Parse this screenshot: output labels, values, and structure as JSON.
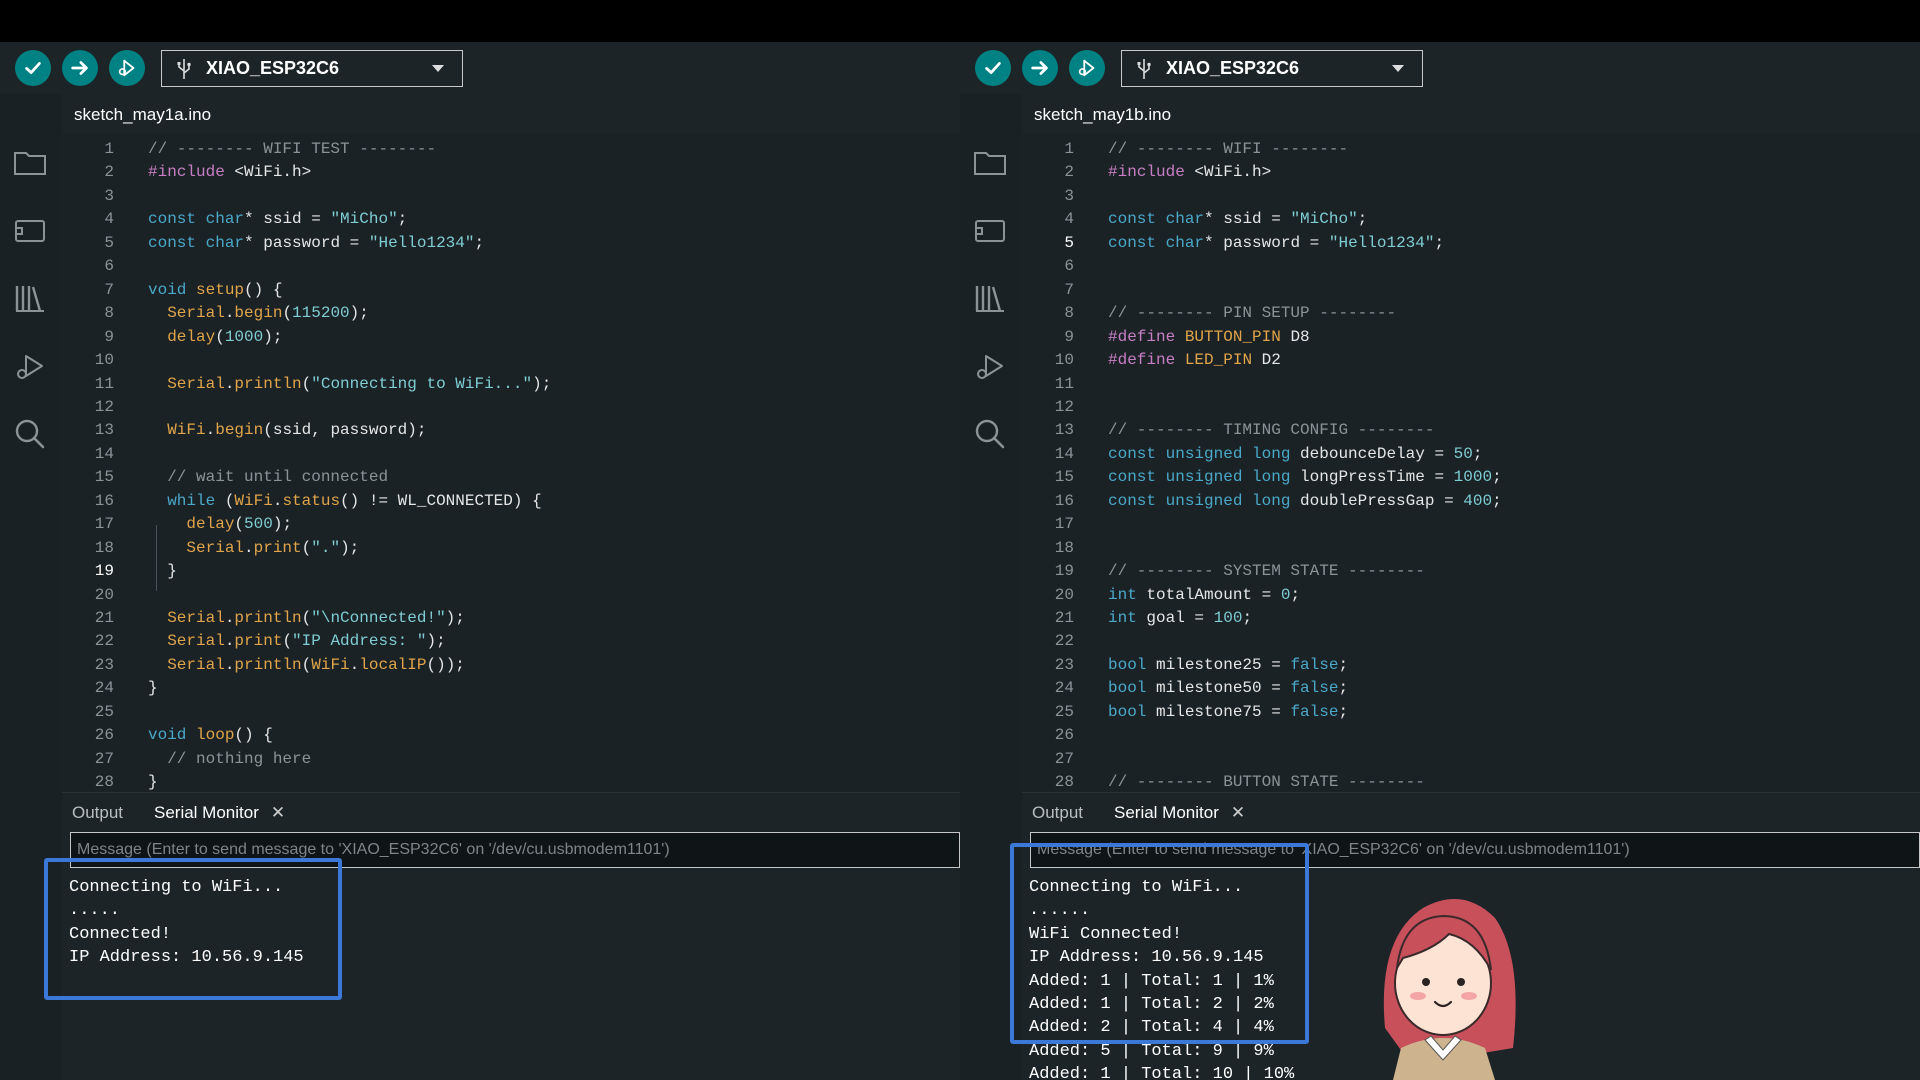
{
  "left": {
    "board": "XIAO_ESP32C6",
    "file_tab": "sketch_may1a.ino",
    "current_line": 19,
    "code": [
      [
        {
          "t": "// -------- WIFI TEST --------",
          "c": "comment"
        }
      ],
      [
        {
          "t": "#include",
          "c": "pre"
        },
        {
          "t": " <WiFi.h>",
          "c": "plain"
        }
      ],
      [],
      [
        {
          "t": "const",
          "c": "kw"
        },
        {
          "t": " ",
          "c": "plain"
        },
        {
          "t": "char",
          "c": "kw"
        },
        {
          "t": "* ssid = ",
          "c": "plain"
        },
        {
          "t": "\"MiCho\"",
          "c": "str"
        },
        {
          "t": ";",
          "c": "plain"
        }
      ],
      [
        {
          "t": "const",
          "c": "kw"
        },
        {
          "t": " ",
          "c": "plain"
        },
        {
          "t": "char",
          "c": "kw"
        },
        {
          "t": "* password = ",
          "c": "plain"
        },
        {
          "t": "\"Hello1234\"",
          "c": "str"
        },
        {
          "t": ";",
          "c": "plain"
        }
      ],
      [],
      [
        {
          "t": "void",
          "c": "kw"
        },
        {
          "t": " ",
          "c": "plain"
        },
        {
          "t": "setup",
          "c": "fn"
        },
        {
          "t": "() {",
          "c": "plain"
        }
      ],
      [
        {
          "t": "  ",
          "c": "plain"
        },
        {
          "t": "Serial",
          "c": "fn"
        },
        {
          "t": ".",
          "c": "plain"
        },
        {
          "t": "begin",
          "c": "fn"
        },
        {
          "t": "(",
          "c": "plain"
        },
        {
          "t": "115200",
          "c": "num"
        },
        {
          "t": ");",
          "c": "plain"
        }
      ],
      [
        {
          "t": "  ",
          "c": "plain"
        },
        {
          "t": "delay",
          "c": "fn"
        },
        {
          "t": "(",
          "c": "plain"
        },
        {
          "t": "1000",
          "c": "num"
        },
        {
          "t": ");",
          "c": "plain"
        }
      ],
      [],
      [
        {
          "t": "  ",
          "c": "plain"
        },
        {
          "t": "Serial",
          "c": "fn"
        },
        {
          "t": ".",
          "c": "plain"
        },
        {
          "t": "println",
          "c": "fn"
        },
        {
          "t": "(",
          "c": "plain"
        },
        {
          "t": "\"Connecting to WiFi...\"",
          "c": "str"
        },
        {
          "t": ");",
          "c": "plain"
        }
      ],
      [],
      [
        {
          "t": "  ",
          "c": "plain"
        },
        {
          "t": "WiFi",
          "c": "fn"
        },
        {
          "t": ".",
          "c": "plain"
        },
        {
          "t": "begin",
          "c": "fn"
        },
        {
          "t": "(ssid, password);",
          "c": "plain"
        }
      ],
      [],
      [
        {
          "t": "  // wait until connected",
          "c": "comment"
        }
      ],
      [
        {
          "t": "  ",
          "c": "plain"
        },
        {
          "t": "while",
          "c": "kw"
        },
        {
          "t": " (",
          "c": "plain"
        },
        {
          "t": "WiFi",
          "c": "fn"
        },
        {
          "t": ".",
          "c": "plain"
        },
        {
          "t": "status",
          "c": "fn"
        },
        {
          "t": "() != WL_CONNECTED) {",
          "c": "plain"
        }
      ],
      [
        {
          "t": "    ",
          "c": "plain"
        },
        {
          "t": "delay",
          "c": "fn"
        },
        {
          "t": "(",
          "c": "plain"
        },
        {
          "t": "500",
          "c": "num"
        },
        {
          "t": ");",
          "c": "plain"
        }
      ],
      [
        {
          "t": "    ",
          "c": "plain"
        },
        {
          "t": "Serial",
          "c": "fn"
        },
        {
          "t": ".",
          "c": "plain"
        },
        {
          "t": "print",
          "c": "fn"
        },
        {
          "t": "(",
          "c": "plain"
        },
        {
          "t": "\".\"",
          "c": "str"
        },
        {
          "t": ");",
          "c": "plain"
        }
      ],
      [
        {
          "t": "  }",
          "c": "plain"
        }
      ],
      [],
      [
        {
          "t": "  ",
          "c": "plain"
        },
        {
          "t": "Serial",
          "c": "fn"
        },
        {
          "t": ".",
          "c": "plain"
        },
        {
          "t": "println",
          "c": "fn"
        },
        {
          "t": "(",
          "c": "plain"
        },
        {
          "t": "\"\\nConnected!\"",
          "c": "str"
        },
        {
          "t": ");",
          "c": "plain"
        }
      ],
      [
        {
          "t": "  ",
          "c": "plain"
        },
        {
          "t": "Serial",
          "c": "fn"
        },
        {
          "t": ".",
          "c": "plain"
        },
        {
          "t": "print",
          "c": "fn"
        },
        {
          "t": "(",
          "c": "plain"
        },
        {
          "t": "\"IP Address: \"",
          "c": "str"
        },
        {
          "t": ");",
          "c": "plain"
        }
      ],
      [
        {
          "t": "  ",
          "c": "plain"
        },
        {
          "t": "Serial",
          "c": "fn"
        },
        {
          "t": ".",
          "c": "plain"
        },
        {
          "t": "println",
          "c": "fn"
        },
        {
          "t": "(",
          "c": "plain"
        },
        {
          "t": "WiFi",
          "c": "fn"
        },
        {
          "t": ".",
          "c": "plain"
        },
        {
          "t": "localIP",
          "c": "fn"
        },
        {
          "t": "());",
          "c": "plain"
        }
      ],
      [
        {
          "t": "}",
          "c": "plain"
        }
      ],
      [],
      [
        {
          "t": "void",
          "c": "kw"
        },
        {
          "t": " ",
          "c": "plain"
        },
        {
          "t": "loop",
          "c": "fn"
        },
        {
          "t": "() {",
          "c": "plain"
        }
      ],
      [
        {
          "t": "  // nothing here",
          "c": "comment"
        }
      ],
      [
        {
          "t": "}",
          "c": "plain"
        }
      ]
    ],
    "output_tab": "Output",
    "serial_tab": "Serial Monitor",
    "close_glyph": "✕",
    "message_placeholder": "Message (Enter to send message to 'XIAO_ESP32C6' on '/dev/cu.usbmodem1101')",
    "serial_output": [
      "Connecting to WiFi...",
      ".....",
      "Connected!",
      "IP Address: 10.56.9.145"
    ]
  },
  "right": {
    "board": "XIAO_ESP32C6",
    "file_tab": "sketch_may1b.ino",
    "current_line": 5,
    "code": [
      [
        {
          "t": "// -------- WIFI --------",
          "c": "comment"
        }
      ],
      [
        {
          "t": "#include",
          "c": "pre"
        },
        {
          "t": " <WiFi.h>",
          "c": "plain"
        }
      ],
      [],
      [
        {
          "t": "const",
          "c": "kw"
        },
        {
          "t": " ",
          "c": "plain"
        },
        {
          "t": "char",
          "c": "kw"
        },
        {
          "t": "* ssid = ",
          "c": "plain"
        },
        {
          "t": "\"MiCho\"",
          "c": "str"
        },
        {
          "t": ";",
          "c": "plain"
        }
      ],
      [
        {
          "t": "const",
          "c": "kw"
        },
        {
          "t": " ",
          "c": "plain"
        },
        {
          "t": "char",
          "c": "kw"
        },
        {
          "t": "* password = ",
          "c": "plain"
        },
        {
          "t": "\"Hello1234\"",
          "c": "str"
        },
        {
          "t": ";",
          "c": "plain"
        }
      ],
      [],
      [],
      [
        {
          "t": "// -------- PIN SETUP --------",
          "c": "comment"
        }
      ],
      [
        {
          "t": "#define",
          "c": "pre"
        },
        {
          "t": " ",
          "c": "plain"
        },
        {
          "t": "BUTTON_PIN",
          "c": "fn"
        },
        {
          "t": " D8",
          "c": "plain"
        }
      ],
      [
        {
          "t": "#define",
          "c": "pre"
        },
        {
          "t": " ",
          "c": "plain"
        },
        {
          "t": "LED_PIN",
          "c": "fn"
        },
        {
          "t": " D2",
          "c": "plain"
        }
      ],
      [],
      [],
      [
        {
          "t": "// -------- TIMING CONFIG --------",
          "c": "comment"
        }
      ],
      [
        {
          "t": "const unsigned long",
          "c": "kw"
        },
        {
          "t": " debounceDelay = ",
          "c": "plain"
        },
        {
          "t": "50",
          "c": "num"
        },
        {
          "t": ";",
          "c": "plain"
        }
      ],
      [
        {
          "t": "const unsigned long",
          "c": "kw"
        },
        {
          "t": " longPressTime = ",
          "c": "plain"
        },
        {
          "t": "1000",
          "c": "num"
        },
        {
          "t": ";",
          "c": "plain"
        }
      ],
      [
        {
          "t": "const unsigned long",
          "c": "kw"
        },
        {
          "t": " doublePressGap = ",
          "c": "plain"
        },
        {
          "t": "400",
          "c": "num"
        },
        {
          "t": ";",
          "c": "plain"
        }
      ],
      [],
      [],
      [
        {
          "t": "// -------- SYSTEM STATE --------",
          "c": "comment"
        }
      ],
      [
        {
          "t": "int",
          "c": "kw"
        },
        {
          "t": " totalAmount = ",
          "c": "plain"
        },
        {
          "t": "0",
          "c": "num"
        },
        {
          "t": ";",
          "c": "plain"
        }
      ],
      [
        {
          "t": "int",
          "c": "kw"
        },
        {
          "t": " goal = ",
          "c": "plain"
        },
        {
          "t": "100",
          "c": "num"
        },
        {
          "t": ";",
          "c": "plain"
        }
      ],
      [],
      [
        {
          "t": "bool",
          "c": "kw"
        },
        {
          "t": " milestone25 = ",
          "c": "plain"
        },
        {
          "t": "false",
          "c": "kw"
        },
        {
          "t": ";",
          "c": "plain"
        }
      ],
      [
        {
          "t": "bool",
          "c": "kw"
        },
        {
          "t": " milestone50 = ",
          "c": "plain"
        },
        {
          "t": "false",
          "c": "kw"
        },
        {
          "t": ";",
          "c": "plain"
        }
      ],
      [
        {
          "t": "bool",
          "c": "kw"
        },
        {
          "t": " milestone75 = ",
          "c": "plain"
        },
        {
          "t": "false",
          "c": "kw"
        },
        {
          "t": ";",
          "c": "plain"
        }
      ],
      [],
      [],
      [
        {
          "t": "// -------- BUTTON STATE --------",
          "c": "comment"
        }
      ]
    ],
    "output_tab": "Output",
    "serial_tab": "Serial Monitor",
    "close_glyph": "✕",
    "message_placeholder": "Message (Enter to send message to 'XIAO_ESP32C6' on '/dev/cu.usbmodem1101')",
    "serial_output": [
      "Connecting to WiFi...",
      "......",
      "WiFi Connected!",
      "IP Address: 10.56.9.145",
      "Added: 1 | Total: 1 | 1%",
      "Added: 1 | Total: 2 | 2%",
      "Added: 2 | Total: 4 | 4%",
      "Added: 5 | Total: 9 | 9%",
      "Added: 1 | Total: 10 | 10%"
    ]
  },
  "colors": {
    "accent": "#008184",
    "comment": "#8a9497",
    "keyword": "#4aa8c9",
    "preprocessor": "#c77fc4",
    "function": "#e0a44a",
    "string": "#7fcdd4",
    "number": "#7fcdd4",
    "highlight_box": "#3b78d8"
  },
  "icons": {
    "verify": "check-icon",
    "upload": "arrow-right-icon",
    "debug": "debug-icon",
    "board": "usb-icon",
    "sidebar": [
      "folder-icon",
      "boards-manager-icon",
      "library-icon",
      "debug-icon",
      "search-icon"
    ]
  }
}
